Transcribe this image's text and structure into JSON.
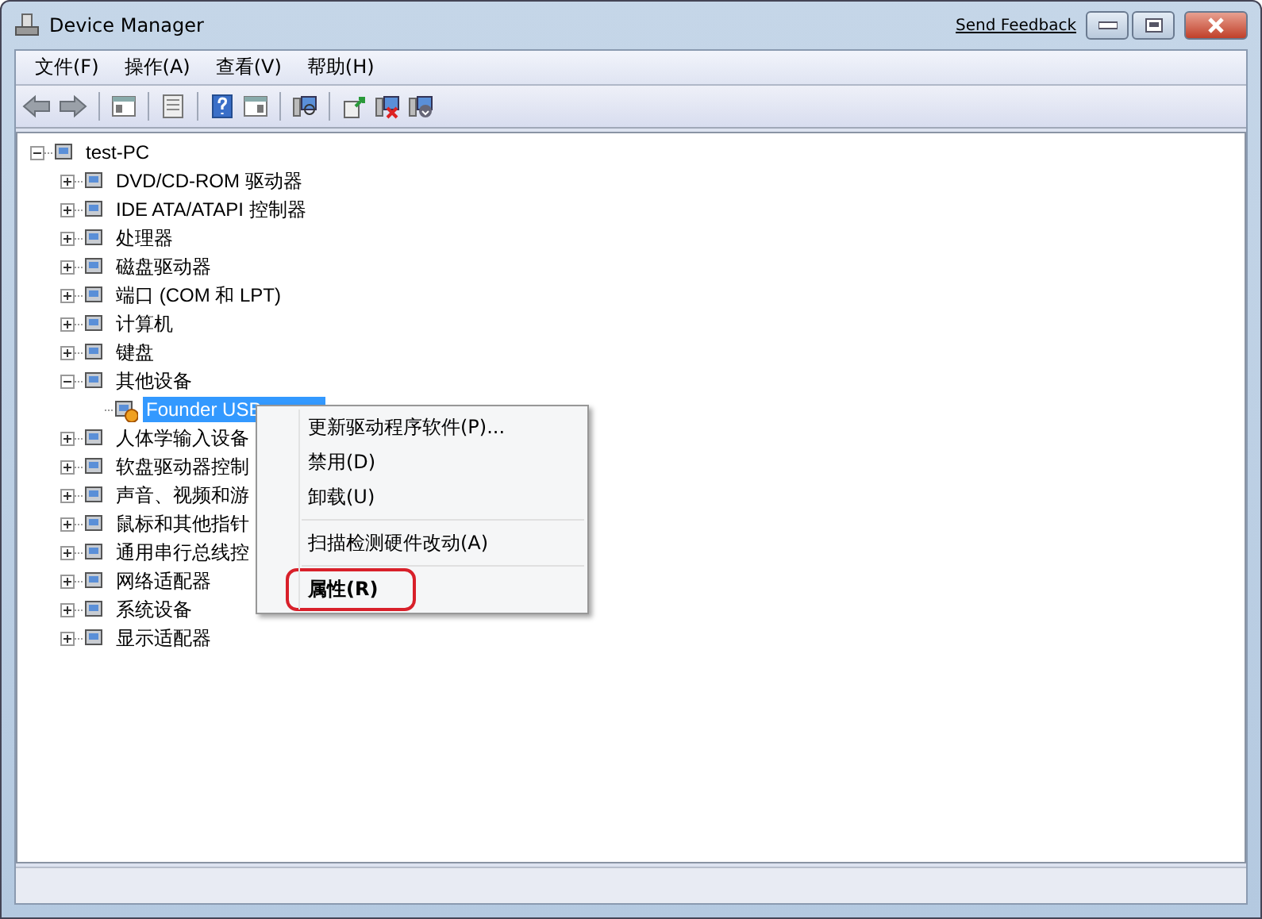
{
  "window": {
    "title": "Device Manager",
    "feedback_link": "Send Feedback"
  },
  "menu_bar": [
    "文件(F)",
    "操作(A)",
    "查看(V)",
    "帮助(H)"
  ],
  "tree": [
    {
      "label": "test-PC",
      "expanded": true,
      "selected": false,
      "warning": false,
      "children": [
        {
          "label": "DVD/CD-ROM 驱动器",
          "expanded": false,
          "selected": false,
          "warning": false
        },
        {
          "label": "IDE ATA/ATAPI 控制器",
          "expanded": false,
          "selected": false,
          "warning": false
        },
        {
          "label": "处理器",
          "expanded": false,
          "selected": false,
          "warning": false
        },
        {
          "label": "磁盘驱动器",
          "expanded": false,
          "selected": false,
          "warning": false
        },
        {
          "label": "端口 (COM 和 LPT)",
          "expanded": false,
          "selected": false,
          "warning": false
        },
        {
          "label": "计算机",
          "expanded": false,
          "selected": false,
          "warning": false
        },
        {
          "label": "键盘",
          "expanded": false,
          "selected": false,
          "warning": false
        },
        {
          "label": "其他设备",
          "expanded": true,
          "selected": false,
          "warning": false,
          "children": [
            {
              "label": "Founder USB",
              "selected": true,
              "warning": true
            }
          ]
        },
        {
          "label": "人体学输入设备",
          "expanded": false,
          "selected": false,
          "warning": false
        },
        {
          "label": "软盘驱动器控制",
          "expanded": false,
          "selected": false,
          "warning": false
        },
        {
          "label": "声音、视频和游",
          "expanded": false,
          "selected": false,
          "warning": false
        },
        {
          "label": "鼠标和其他指针",
          "expanded": false,
          "selected": false,
          "warning": false
        },
        {
          "label": "通用串行总线控",
          "expanded": false,
          "selected": false,
          "warning": false
        },
        {
          "label": "网络适配器",
          "expanded": false,
          "selected": false,
          "warning": false
        },
        {
          "label": "系统设备",
          "expanded": false,
          "selected": false,
          "warning": false
        },
        {
          "label": "显示适配器",
          "expanded": false,
          "selected": false,
          "warning": false
        }
      ]
    }
  ],
  "context_menu": [
    {
      "kind": "item",
      "label": "更新驱动程序软件(P)...",
      "default": false,
      "circled": false
    },
    {
      "kind": "item",
      "label": "禁用(D)",
      "default": false,
      "circled": false
    },
    {
      "kind": "item",
      "label": "卸载(U)",
      "default": false,
      "circled": false
    },
    {
      "kind": "separator"
    },
    {
      "kind": "item",
      "label": "扫描检测硬件改动(A)",
      "default": false,
      "circled": false
    },
    {
      "kind": "separator"
    },
    {
      "kind": "item",
      "label": "属性(R)",
      "default": true,
      "circled": true
    }
  ]
}
